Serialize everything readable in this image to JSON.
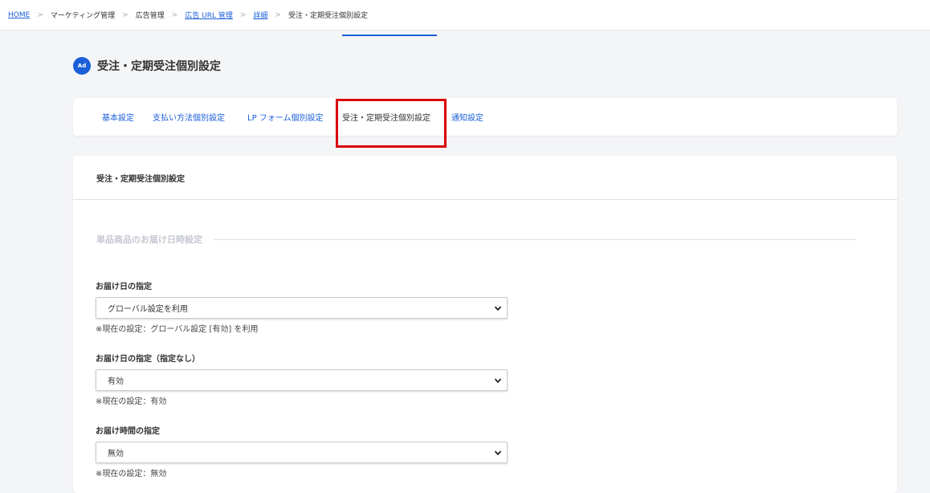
{
  "breadcrumb": [
    {
      "label": "HOME",
      "link": true
    },
    {
      "label": "マーケティング管理",
      "link": false
    },
    {
      "label": "広告管理",
      "link": false
    },
    {
      "label": "広告 URL 管理",
      "link": true
    },
    {
      "label": "詳細",
      "link": true
    },
    {
      "label": "受注・定期受注個別設定",
      "link": false
    }
  ],
  "separator": ">",
  "header": {
    "icon_text": "Ad",
    "title": "受注・定期受注個別設定"
  },
  "tabs": [
    {
      "label": "基本設定"
    },
    {
      "label": "支払い方法個別設定"
    },
    {
      "label": "LP フォーム個別設定"
    },
    {
      "label": "受注・定期受注個別設定"
    },
    {
      "label": "通知設定"
    }
  ],
  "card": {
    "title": "受注・定期受注個別設定",
    "section_heading": "単品商品のお届け日時設定",
    "fields": [
      {
        "label": "お届け日の指定",
        "value": "グローバル設定を利用",
        "note": "※現在の設定：グローバル設定 [有効] を利用"
      },
      {
        "label": "お届け日の指定（指定なし）",
        "value": "有効",
        "note": "※現在の設定：有効"
      },
      {
        "label": "お届け時間の指定",
        "value": "無効",
        "note": "※現在の設定：無効"
      }
    ]
  },
  "colors": {
    "accent": "#1a5fd8",
    "highlight": "#d90000"
  }
}
